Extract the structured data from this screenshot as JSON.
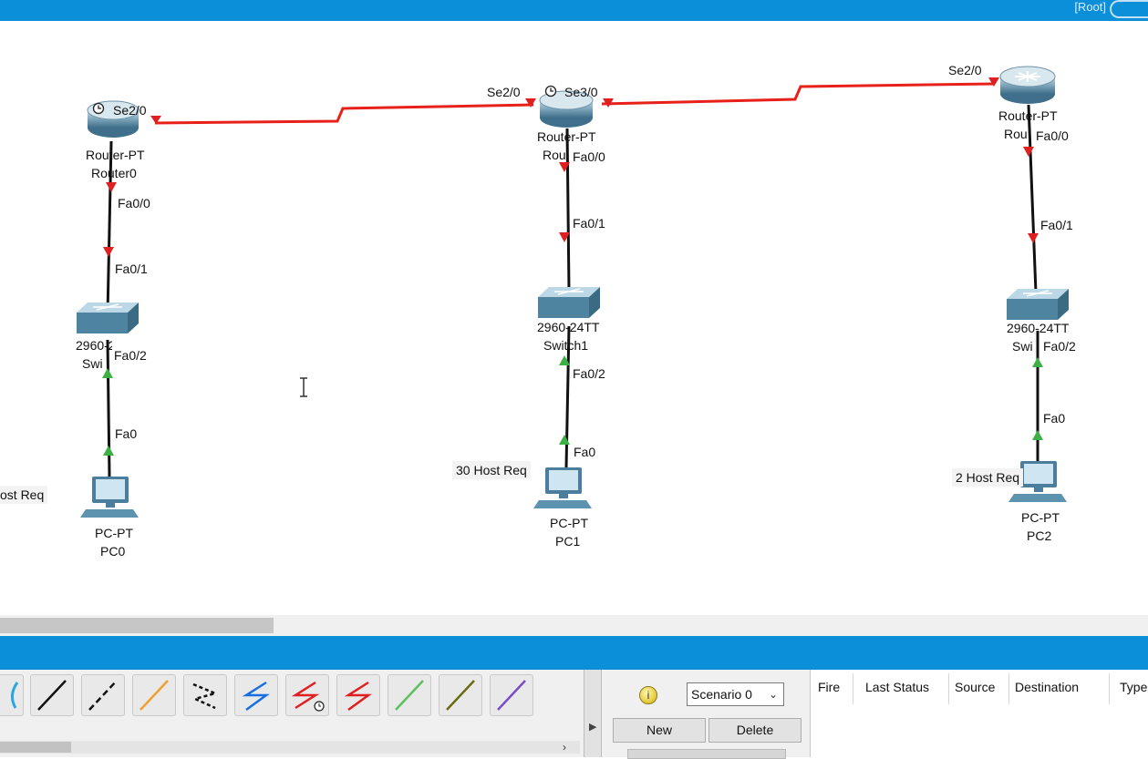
{
  "window": {
    "root_label": "[Root]"
  },
  "topology": {
    "devices": [
      {
        "id": "router0",
        "type": "router",
        "model": "Router-PT",
        "name": "Router0"
      },
      {
        "id": "router1",
        "type": "router",
        "model": "Router-PT",
        "name": "Rou"
      },
      {
        "id": "router2",
        "type": "router",
        "model": "Router-PT",
        "name": "Rou"
      },
      {
        "id": "switch0",
        "type": "switch",
        "model": "2960-24TT",
        "name": "Swi"
      },
      {
        "id": "switch1",
        "type": "switch",
        "model": "2960-24TT",
        "name": "Switch1"
      },
      {
        "id": "switch2",
        "type": "switch",
        "model": "2960-24TT",
        "name": "Swi"
      },
      {
        "id": "pc0",
        "type": "pc",
        "model": "PC-PT",
        "name": "PC0"
      },
      {
        "id": "pc1",
        "type": "pc",
        "model": "PC-PT",
        "name": "PC1"
      },
      {
        "id": "pc2",
        "type": "pc",
        "model": "PC-PT",
        "name": "PC2"
      }
    ],
    "port_labels": {
      "r0_serial": "Se2/0",
      "r1_serial_left": "Se2/0",
      "r1_serial_right": "Se3/0",
      "r2_serial": "Se2/0",
      "r0_fa": "Fa0/0",
      "sw0_up": "Fa0/1",
      "sw0_down": "Fa0/2",
      "pc0_port": "Fa0",
      "r1_fa": "Fa0/0",
      "sw1_up": "Fa0/1",
      "sw1_down": "Fa0/2",
      "pc1_port": "Fa0",
      "r2_fa": "Fa0/0",
      "sw2_up": "Fa0/1",
      "sw2_down": "Fa0/2",
      "pc2_port": "Fa0"
    },
    "notes": {
      "left": "ost Req",
      "middle": "30 Host Req",
      "right": "2 Host Req"
    },
    "colors": {
      "serial_link": "#e8201a",
      "ethernet_link": "#111111",
      "link_down": "#e02020",
      "link_up": "#3cb043"
    }
  },
  "connections_toolbar": {
    "items": [
      {
        "name": "console-cable-icon",
        "color": "#2aa7e0"
      },
      {
        "name": "straight-through-cable-icon",
        "color": "#111111"
      },
      {
        "name": "crossover-cable-icon",
        "color": "#111111"
      },
      {
        "name": "fiber-cable-icon",
        "color": "#f0a030"
      },
      {
        "name": "phone-cable-icon",
        "color": "#111111"
      },
      {
        "name": "coaxial-cable-icon",
        "color": "#1a6fe0"
      },
      {
        "name": "serial-dce-cable-icon",
        "color": "#e02020"
      },
      {
        "name": "serial-dte-cable-icon",
        "color": "#e02020"
      },
      {
        "name": "octal-cable-icon",
        "color": "#5cc05c"
      },
      {
        "name": "iot-custom-cable-icon",
        "color": "#6b6b10"
      },
      {
        "name": "usb-cable-icon",
        "color": "#7a4cc9"
      }
    ]
  },
  "scenario": {
    "selected": "Scenario 0",
    "new_label": "New",
    "delete_label": "Delete"
  },
  "pdu_table": {
    "columns": [
      "Fire",
      "Last Status",
      "Source",
      "Destination",
      "Type"
    ]
  }
}
